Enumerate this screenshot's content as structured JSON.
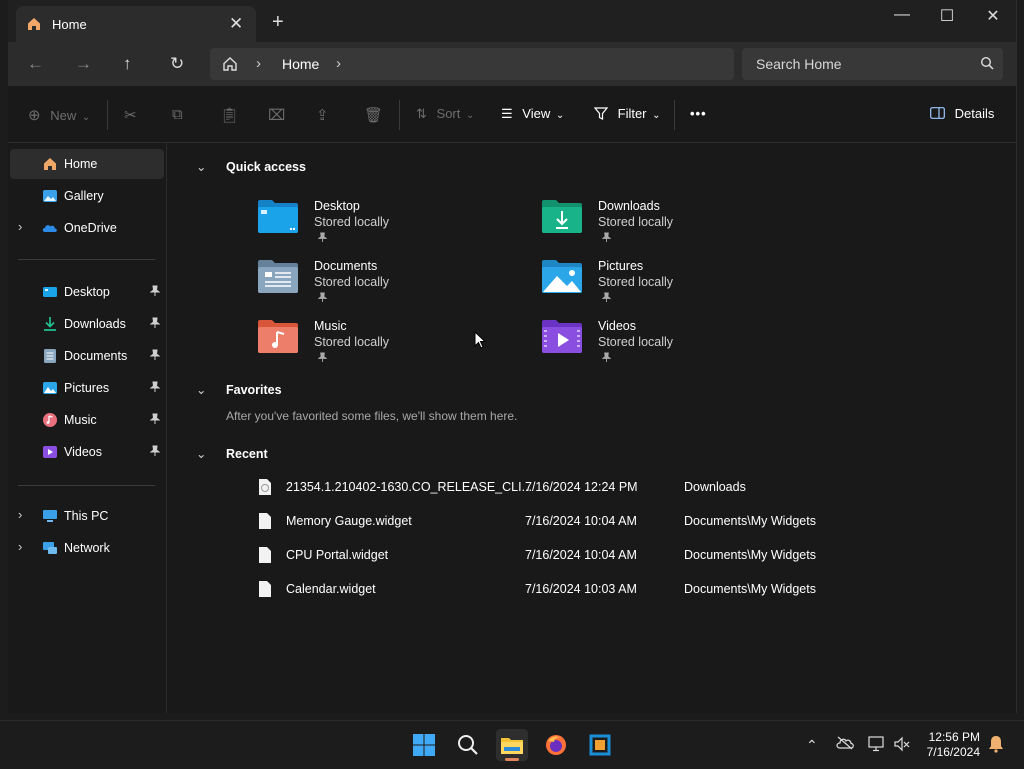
{
  "window": {
    "tab_title": "Home",
    "close_tab": "✕",
    "new_tab": "+",
    "minimize": "—",
    "maximize": "☐",
    "close": "✕"
  },
  "nav": {
    "back": "←",
    "forward": "→",
    "up": "↑",
    "refresh": "↻",
    "breadcrumb": [
      "Home"
    ],
    "search_placeholder": "Search Home"
  },
  "toolbar": {
    "new_label": "New",
    "sort_label": "Sort",
    "view_label": "View",
    "filter_label": "Filter",
    "more_label": "•••",
    "details_label": "Details"
  },
  "sidebar": {
    "top": [
      {
        "label": "Home",
        "icon": "home-icon",
        "selected": true
      },
      {
        "label": "Gallery",
        "icon": "gallery-icon"
      },
      {
        "label": "OneDrive",
        "icon": "onedrive-icon",
        "expandable": true
      }
    ],
    "pinned": [
      {
        "label": "Desktop",
        "icon": "desktop-folder-icon"
      },
      {
        "label": "Downloads",
        "icon": "downloads-icon"
      },
      {
        "label": "Documents",
        "icon": "documents-icon"
      },
      {
        "label": "Pictures",
        "icon": "pictures-icon"
      },
      {
        "label": "Music",
        "icon": "music-icon"
      },
      {
        "label": "Videos",
        "icon": "videos-icon"
      }
    ],
    "bottom": [
      {
        "label": "This PC",
        "icon": "pc-icon",
        "expandable": true
      },
      {
        "label": "Network",
        "icon": "network-icon",
        "expandable": true
      }
    ]
  },
  "quick_access": {
    "title": "Quick access",
    "items": [
      {
        "name": "Desktop",
        "sub": "Stored locally",
        "color": "#1aa3e8"
      },
      {
        "name": "Downloads",
        "sub": "Stored locally",
        "color": "#19b38a"
      },
      {
        "name": "Documents",
        "sub": "Stored locally",
        "color": "#7f9cb3"
      },
      {
        "name": "Pictures",
        "sub": "Stored locally",
        "color": "#2ba6e8"
      },
      {
        "name": "Music",
        "sub": "Stored locally",
        "color": "#e8734a"
      },
      {
        "name": "Videos",
        "sub": "Stored locally",
        "color": "#8a4fe0"
      }
    ]
  },
  "favorites": {
    "title": "Favorites",
    "empty_message": "After you've favorited some files, we'll show them here."
  },
  "recent": {
    "title": "Recent",
    "rows": [
      {
        "name": "21354.1.210402-1630.CO_RELEASE_CLI...",
        "date": "7/16/2024 12:24 PM",
        "location": "Downloads"
      },
      {
        "name": "Memory Gauge.widget",
        "date": "7/16/2024 10:04 AM",
        "location": "Documents\\My Widgets"
      },
      {
        "name": "CPU Portal.widget",
        "date": "7/16/2024 10:04 AM",
        "location": "Documents\\My Widgets"
      },
      {
        "name": "Calendar.widget",
        "date": "7/16/2024 10:03 AM",
        "location": "Documents\\My Widgets"
      }
    ]
  },
  "taskbar": {
    "time": "12:56 PM",
    "date": "7/16/2024",
    "tray_chevron": "^"
  }
}
